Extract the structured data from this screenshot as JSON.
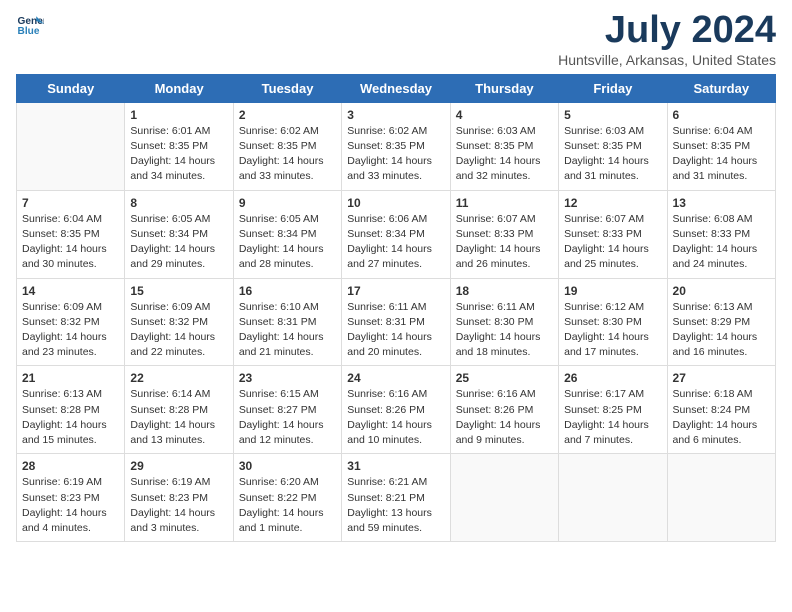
{
  "header": {
    "logo_line1": "General",
    "logo_line2": "Blue",
    "month": "July 2024",
    "location": "Huntsville, Arkansas, United States"
  },
  "days_of_week": [
    "Sunday",
    "Monday",
    "Tuesday",
    "Wednesday",
    "Thursday",
    "Friday",
    "Saturday"
  ],
  "weeks": [
    [
      {
        "day": "",
        "info": ""
      },
      {
        "day": "1",
        "info": "Sunrise: 6:01 AM\nSunset: 8:35 PM\nDaylight: 14 hours\nand 34 minutes."
      },
      {
        "day": "2",
        "info": "Sunrise: 6:02 AM\nSunset: 8:35 PM\nDaylight: 14 hours\nand 33 minutes."
      },
      {
        "day": "3",
        "info": "Sunrise: 6:02 AM\nSunset: 8:35 PM\nDaylight: 14 hours\nand 33 minutes."
      },
      {
        "day": "4",
        "info": "Sunrise: 6:03 AM\nSunset: 8:35 PM\nDaylight: 14 hours\nand 32 minutes."
      },
      {
        "day": "5",
        "info": "Sunrise: 6:03 AM\nSunset: 8:35 PM\nDaylight: 14 hours\nand 31 minutes."
      },
      {
        "day": "6",
        "info": "Sunrise: 6:04 AM\nSunset: 8:35 PM\nDaylight: 14 hours\nand 31 minutes."
      }
    ],
    [
      {
        "day": "7",
        "info": "Sunrise: 6:04 AM\nSunset: 8:35 PM\nDaylight: 14 hours\nand 30 minutes."
      },
      {
        "day": "8",
        "info": "Sunrise: 6:05 AM\nSunset: 8:34 PM\nDaylight: 14 hours\nand 29 minutes."
      },
      {
        "day": "9",
        "info": "Sunrise: 6:05 AM\nSunset: 8:34 PM\nDaylight: 14 hours\nand 28 minutes."
      },
      {
        "day": "10",
        "info": "Sunrise: 6:06 AM\nSunset: 8:34 PM\nDaylight: 14 hours\nand 27 minutes."
      },
      {
        "day": "11",
        "info": "Sunrise: 6:07 AM\nSunset: 8:33 PM\nDaylight: 14 hours\nand 26 minutes."
      },
      {
        "day": "12",
        "info": "Sunrise: 6:07 AM\nSunset: 8:33 PM\nDaylight: 14 hours\nand 25 minutes."
      },
      {
        "day": "13",
        "info": "Sunrise: 6:08 AM\nSunset: 8:33 PM\nDaylight: 14 hours\nand 24 minutes."
      }
    ],
    [
      {
        "day": "14",
        "info": "Sunrise: 6:09 AM\nSunset: 8:32 PM\nDaylight: 14 hours\nand 23 minutes."
      },
      {
        "day": "15",
        "info": "Sunrise: 6:09 AM\nSunset: 8:32 PM\nDaylight: 14 hours\nand 22 minutes."
      },
      {
        "day": "16",
        "info": "Sunrise: 6:10 AM\nSunset: 8:31 PM\nDaylight: 14 hours\nand 21 minutes."
      },
      {
        "day": "17",
        "info": "Sunrise: 6:11 AM\nSunset: 8:31 PM\nDaylight: 14 hours\nand 20 minutes."
      },
      {
        "day": "18",
        "info": "Sunrise: 6:11 AM\nSunset: 8:30 PM\nDaylight: 14 hours\nand 18 minutes."
      },
      {
        "day": "19",
        "info": "Sunrise: 6:12 AM\nSunset: 8:30 PM\nDaylight: 14 hours\nand 17 minutes."
      },
      {
        "day": "20",
        "info": "Sunrise: 6:13 AM\nSunset: 8:29 PM\nDaylight: 14 hours\nand 16 minutes."
      }
    ],
    [
      {
        "day": "21",
        "info": "Sunrise: 6:13 AM\nSunset: 8:28 PM\nDaylight: 14 hours\nand 15 minutes."
      },
      {
        "day": "22",
        "info": "Sunrise: 6:14 AM\nSunset: 8:28 PM\nDaylight: 14 hours\nand 13 minutes."
      },
      {
        "day": "23",
        "info": "Sunrise: 6:15 AM\nSunset: 8:27 PM\nDaylight: 14 hours\nand 12 minutes."
      },
      {
        "day": "24",
        "info": "Sunrise: 6:16 AM\nSunset: 8:26 PM\nDaylight: 14 hours\nand 10 minutes."
      },
      {
        "day": "25",
        "info": "Sunrise: 6:16 AM\nSunset: 8:26 PM\nDaylight: 14 hours\nand 9 minutes."
      },
      {
        "day": "26",
        "info": "Sunrise: 6:17 AM\nSunset: 8:25 PM\nDaylight: 14 hours\nand 7 minutes."
      },
      {
        "day": "27",
        "info": "Sunrise: 6:18 AM\nSunset: 8:24 PM\nDaylight: 14 hours\nand 6 minutes."
      }
    ],
    [
      {
        "day": "28",
        "info": "Sunrise: 6:19 AM\nSunset: 8:23 PM\nDaylight: 14 hours\nand 4 minutes."
      },
      {
        "day": "29",
        "info": "Sunrise: 6:19 AM\nSunset: 8:23 PM\nDaylight: 14 hours\nand 3 minutes."
      },
      {
        "day": "30",
        "info": "Sunrise: 6:20 AM\nSunset: 8:22 PM\nDaylight: 14 hours\nand 1 minute."
      },
      {
        "day": "31",
        "info": "Sunrise: 6:21 AM\nSunset: 8:21 PM\nDaylight: 13 hours\nand 59 minutes."
      },
      {
        "day": "",
        "info": ""
      },
      {
        "day": "",
        "info": ""
      },
      {
        "day": "",
        "info": ""
      }
    ]
  ]
}
